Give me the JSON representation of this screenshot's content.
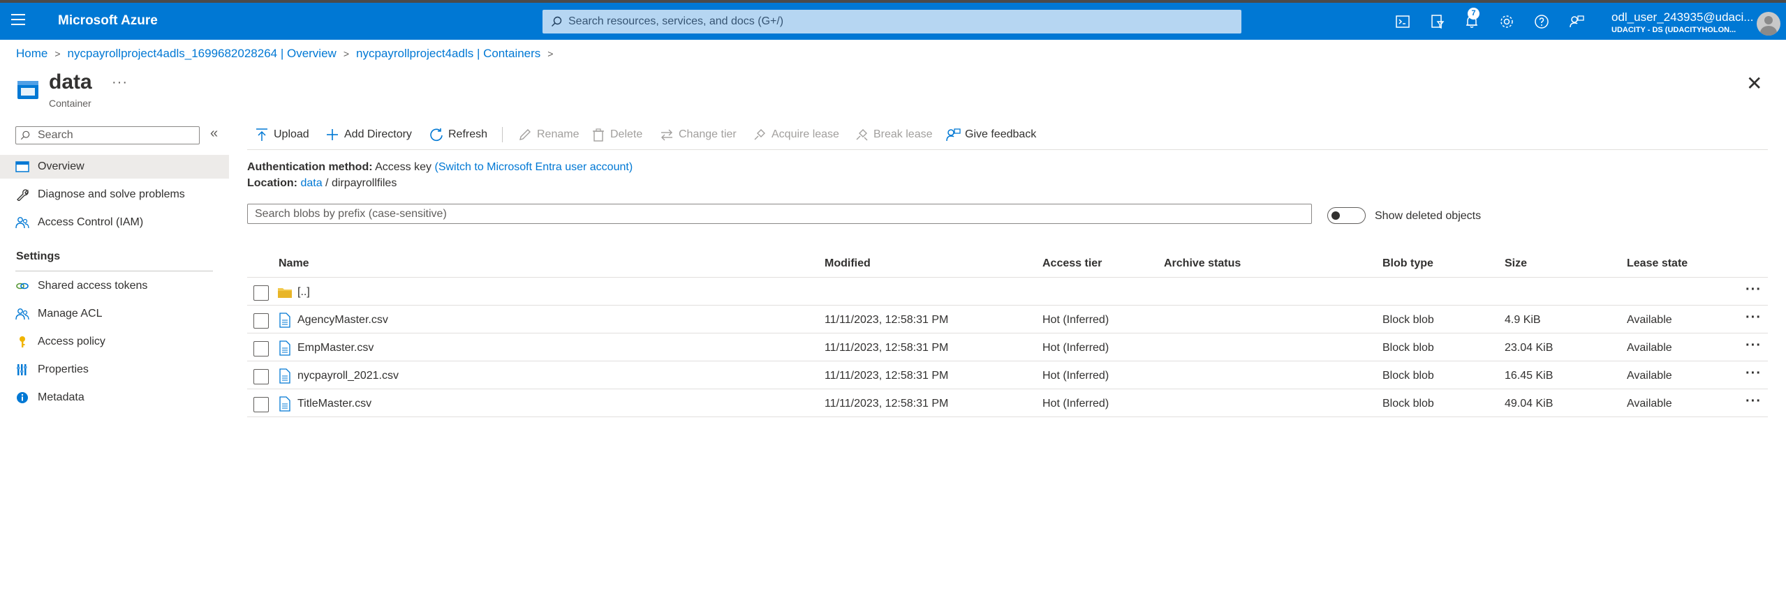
{
  "header": {
    "brand": "Microsoft Azure",
    "search_placeholder": "Search resources, services, and docs (G+/)",
    "notification_count": "7",
    "user_name": "odl_user_243935@udaci...",
    "user_org": "UDACITY - DS (UDACITYHOLON..."
  },
  "breadcrumb": [
    "Home",
    "nycpayrollproject4adls_1699682028264 | Overview",
    "nycpayrollproject4adls | Containers"
  ],
  "page": {
    "title": "data",
    "subtitle": "Container",
    "more": "···",
    "close": "✕"
  },
  "nav": {
    "search_placeholder": "Search",
    "collapse": "«",
    "items": [
      {
        "label": "Overview",
        "icon": "container-overview-icon",
        "active": true
      },
      {
        "label": "Diagnose and solve problems",
        "icon": "wrench-icon"
      },
      {
        "label": "Access Control (IAM)",
        "icon": "people-icon"
      }
    ],
    "section": "Settings",
    "settings_items": [
      {
        "label": "Shared access tokens",
        "icon": "link-icon"
      },
      {
        "label": "Manage ACL",
        "icon": "people-icon"
      },
      {
        "label": "Access policy",
        "icon": "key-icon"
      },
      {
        "label": "Properties",
        "icon": "properties-bars-icon"
      },
      {
        "label": "Metadata",
        "icon": "info-icon"
      }
    ]
  },
  "commands": {
    "upload": "Upload",
    "add_directory": "Add Directory",
    "refresh": "Refresh",
    "rename": "Rename",
    "delete": "Delete",
    "change_tier": "Change tier",
    "acquire_lease": "Acquire lease",
    "break_lease": "Break lease",
    "give_feedback": "Give feedback"
  },
  "info": {
    "auth_label": "Authentication method:",
    "auth_value": "Access key",
    "auth_link": "(Switch to Microsoft Entra user account)",
    "location_label": "Location:",
    "location_link": "data",
    "location_sep": "/",
    "location_dir": "dirpayrollfiles",
    "blob_search_placeholder": "Search blobs by prefix (case-sensitive)",
    "show_deleted": "Show deleted objects"
  },
  "table": {
    "columns": [
      "Name",
      "Modified",
      "Access tier",
      "Archive status",
      "Blob type",
      "Size",
      "Lease state"
    ],
    "parent_row": {
      "name": "[..]"
    },
    "rows": [
      {
        "name": "AgencyMaster.csv",
        "modified": "11/11/2023, 12:58:31 PM",
        "tier": "Hot (Inferred)",
        "archive": "",
        "type": "Block blob",
        "size": "4.9 KiB",
        "lease": "Available"
      },
      {
        "name": "EmpMaster.csv",
        "modified": "11/11/2023, 12:58:31 PM",
        "tier": "Hot (Inferred)",
        "archive": "",
        "type": "Block blob",
        "size": "23.04 KiB",
        "lease": "Available"
      },
      {
        "name": "nycpayroll_2021.csv",
        "modified": "11/11/2023, 12:58:31 PM",
        "tier": "Hot (Inferred)",
        "archive": "",
        "type": "Block blob",
        "size": "16.45 KiB",
        "lease": "Available"
      },
      {
        "name": "TitleMaster.csv",
        "modified": "11/11/2023, 12:58:31 PM",
        "tier": "Hot (Inferred)",
        "archive": "",
        "type": "Block blob",
        "size": "49.04 KiB",
        "lease": "Available"
      }
    ],
    "more": "···"
  },
  "colors": {
    "header_bg": "#0078d4",
    "link": "#0078d4",
    "folder": "#f2c94c",
    "key": "#f0b400"
  }
}
